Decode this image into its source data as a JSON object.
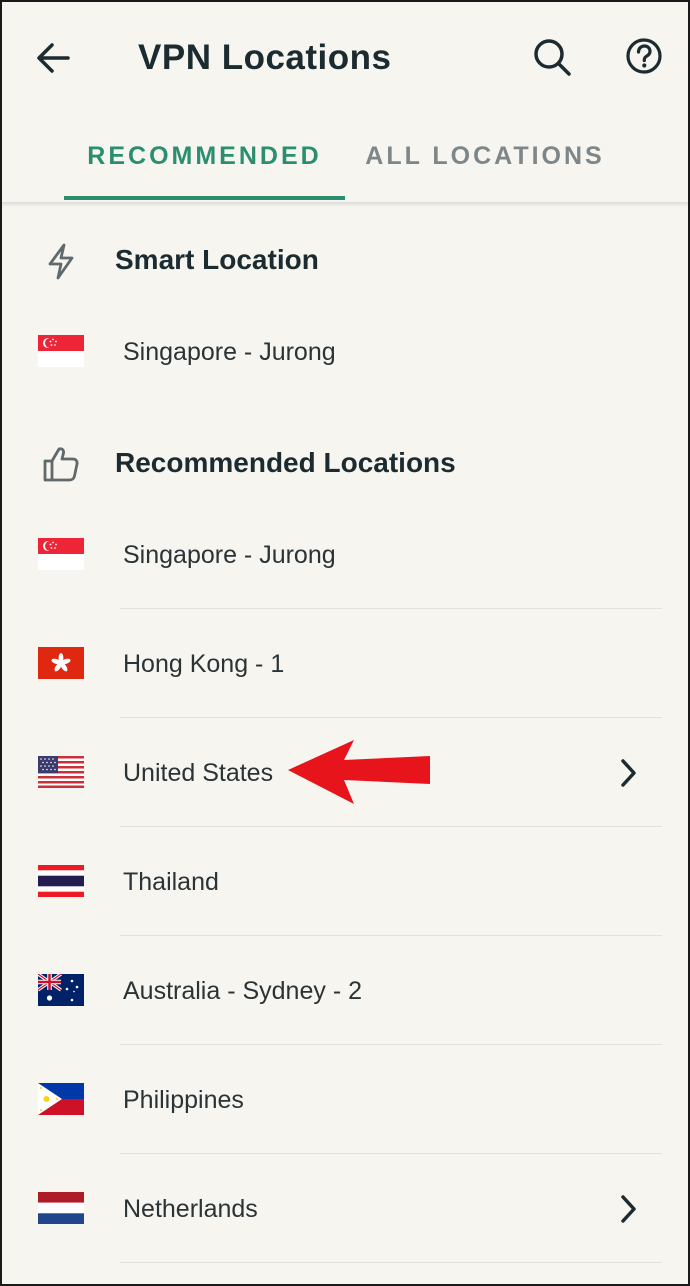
{
  "header": {
    "title": "VPN Locations"
  },
  "tabs": [
    {
      "label": "RECOMMENDED",
      "active": true
    },
    {
      "label": "ALL LOCATIONS",
      "active": false
    }
  ],
  "colors": {
    "accent": "#2b8e70",
    "inactive_tab": "#7d8688",
    "background": "#f6f5f0",
    "annotation_arrow": "#e8141c"
  },
  "smart_section": {
    "heading": "Smart Location",
    "icon": "lightning-bolt-icon",
    "item": {
      "label": "Singapore - Jurong",
      "flag": "singapore-flag"
    }
  },
  "recommended_section": {
    "heading": "Recommended Locations",
    "icon": "thumbs-up-icon",
    "items": [
      {
        "label": "Singapore - Jurong",
        "flag": "singapore-flag",
        "has_chevron": false
      },
      {
        "label": "Hong Kong - 1",
        "flag": "hong-kong-flag",
        "has_chevron": false
      },
      {
        "label": "United States",
        "flag": "united-states-flag",
        "has_chevron": true
      },
      {
        "label": "Thailand",
        "flag": "thailand-flag",
        "has_chevron": false
      },
      {
        "label": "Australia - Sydney - 2",
        "flag": "australia-flag",
        "has_chevron": false
      },
      {
        "label": "Philippines",
        "flag": "philippines-flag",
        "has_chevron": false
      },
      {
        "label": "Netherlands",
        "flag": "netherlands-flag",
        "has_chevron": true
      }
    ]
  }
}
